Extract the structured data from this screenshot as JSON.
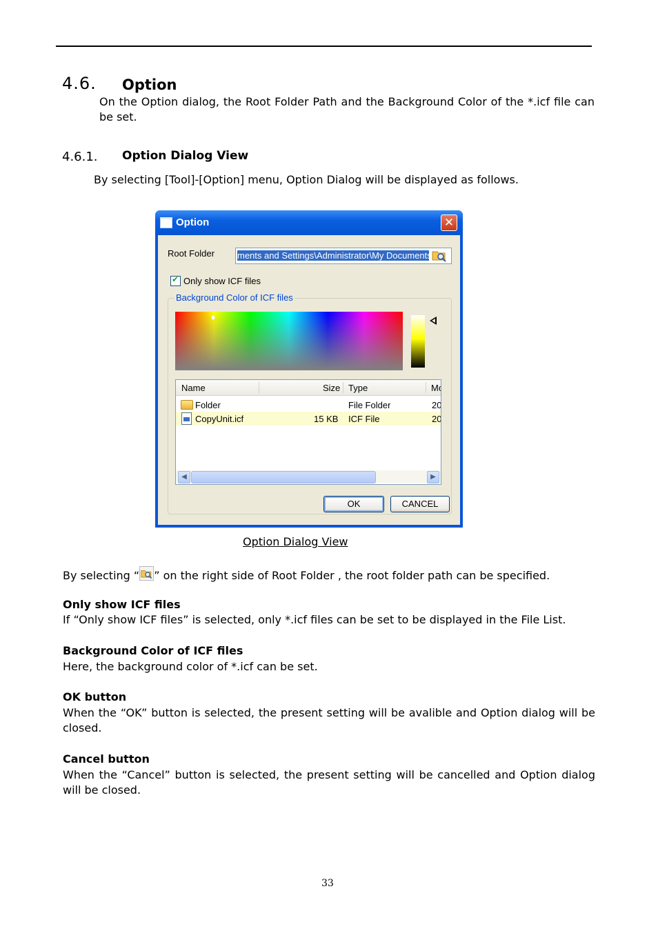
{
  "section": {
    "number": "4.6.",
    "title": "Option",
    "intro": "On the Option dialog, the Root Folder Path and the Background Color of the *.icf file can be set."
  },
  "subsection": {
    "number": "4.6.1.",
    "title": "Option Dialog View",
    "intro": "By selecting [Tool]-[Option] menu, Option Dialog will be displayed as follows."
  },
  "dialog": {
    "title": "Option",
    "close_glyph": "✕",
    "root_folder_label": "Root Folder",
    "root_folder_value": "ments and Settings\\Administrator\\My Documents",
    "only_show_icf_label": "Only show ICF files",
    "only_show_icf_checked": true,
    "bg_color_group_label": "Background Color of ICF files",
    "file_list": {
      "columns": [
        "Name",
        "Size",
        "Type",
        "Mo"
      ],
      "rows": [
        {
          "name": "Folder",
          "size": "",
          "type": "File Folder",
          "modified": "20",
          "icon": "folder-icon",
          "selected": false
        },
        {
          "name": "CopyUnit.icf",
          "size": "15 KB",
          "type": "ICF File",
          "modified": "20",
          "icon": "icf-file-icon",
          "selected": true
        }
      ]
    },
    "ok_label": "OK",
    "cancel_label": "CANCEL"
  },
  "caption": "Option Dialog View",
  "body": {
    "select_root_prefix": "By selecting “",
    "select_root_suffix": "” on the right side of Root Folder , the root folder path can be specified.",
    "only_show_heading": "Only show ICF files",
    "only_show_text": "If “Only show ICF files” is selected, only *.icf files can be set to be displayed in the File List.",
    "bg_heading": "Background Color of ICF files",
    "bg_text": "Here, the background color of *.icf can be set.",
    "ok_heading": "OK button",
    "ok_text": "When the “OK” button is selected, the present setting will be avalible and Option dialog will be closed.",
    "cancel_heading": "Cancel button",
    "cancel_text": "When the “Cancel” button is selected, the present setting will be cancelled and Option dialog will be closed."
  },
  "page_number": "33",
  "colors": {
    "titlebar": "#0a5fe0",
    "dialog_face": "#ece9d8",
    "selection": "#316ac5",
    "group_label": "#0046d5",
    "selected_row": "#fdfcd0"
  }
}
